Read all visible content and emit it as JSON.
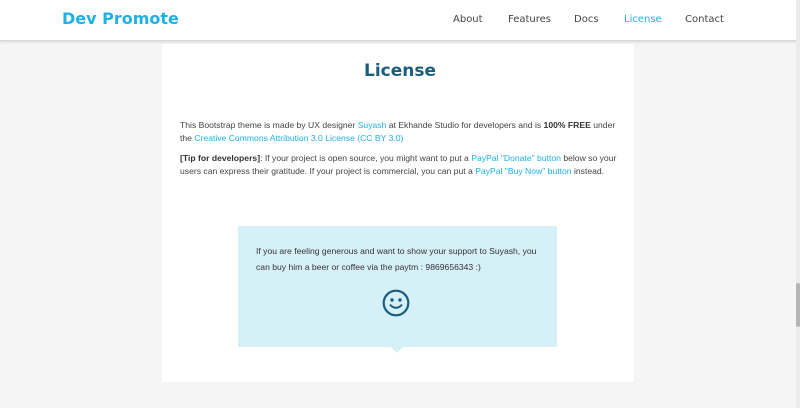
{
  "nav": {
    "brand": "Dev Promote",
    "links": [
      {
        "label": "About"
      },
      {
        "label": "Features"
      },
      {
        "label": "Docs"
      },
      {
        "label": "License",
        "active": true
      },
      {
        "label": "Contact"
      }
    ]
  },
  "license": {
    "title": "License",
    "p1": {
      "t1": "This Bootstrap theme is made by UX designer ",
      "link1": "Suyash",
      "t2": " at Ekhande Studio for developers and is ",
      "bold": "100% FREE",
      "t3": " under the ",
      "link2": "Creative Commons Attribution 3.0 License (CC BY 3.0)"
    },
    "p2": {
      "bold": "[Tip for developers]",
      "t1": ": If your project is open source, you might want to put a ",
      "link1": "PayPal \"Donate\" button",
      "t2": " below so your users can express their gratitude. If your project is commercial, you can put a ",
      "link2": "PayPal \"Buy Now\" button",
      "t3": " instead."
    }
  },
  "callout": {
    "text": "If you are feeling generous and want to show your support to Suyash, you can buy him a beer or coffee via the paytm : 9869656343 :)",
    "icon": "smiley-icon"
  },
  "colors": {
    "accent": "#1fb1e4",
    "title": "#1a5e7d",
    "callout_bg": "#d6f0f8"
  }
}
